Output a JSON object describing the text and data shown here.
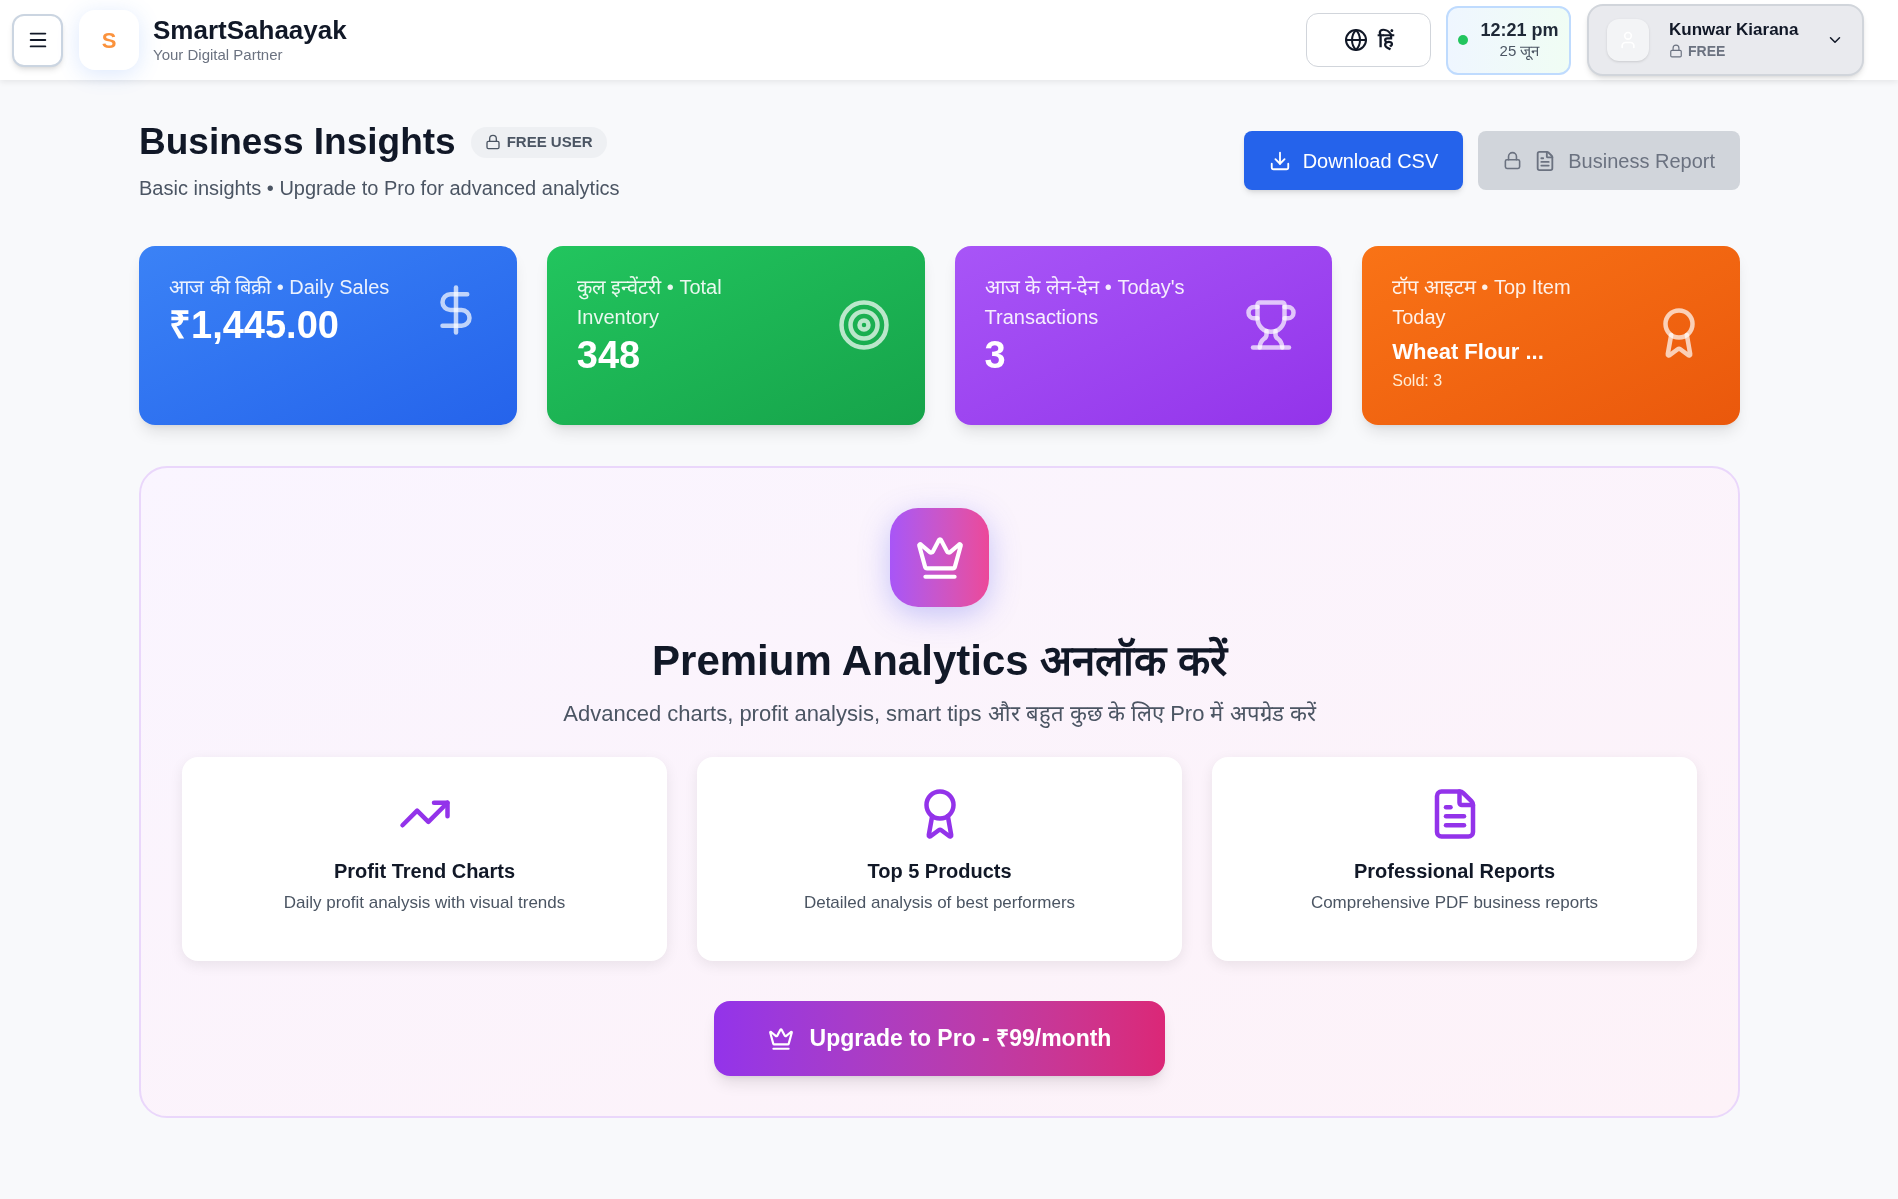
{
  "header": {
    "logo_letter": "S",
    "app_name": "SmartSahaayak",
    "tagline": "Your Digital Partner",
    "language": "हिं",
    "clock": {
      "time": "12:21 pm",
      "date": "25 जून"
    },
    "user": {
      "name": "Kunwar Kiarana",
      "plan": "FREE"
    }
  },
  "page": {
    "title": "Business Insights",
    "badge": "FREE USER",
    "subtitle": "Basic insights • Upgrade to Pro for advanced analytics",
    "actions": [
      {
        "kind": "download",
        "label": "Download CSV",
        "disabled": false
      },
      {
        "kind": "report",
        "label": "Business Report",
        "disabled": true
      }
    ]
  },
  "stats": [
    {
      "kind": "sales",
      "label": "आज की बिक्री • Daily Sales",
      "value": "₹1,445.00"
    },
    {
      "kind": "inventory",
      "label": "कुल इन्वेंटरी • Total Inventory",
      "value": "348"
    },
    {
      "kind": "transactions",
      "label": "आज के लेन-देन • Today's Transactions",
      "value": "3"
    },
    {
      "kind": "top_item",
      "label": "टॉप आइटम • Top Item Today",
      "value": "Wheat Flour ...",
      "note": "Sold: 3"
    }
  ],
  "premium": {
    "title": "Premium Analytics अनलॉक करें",
    "subtitle": "Advanced charts, profit analysis, smart tips और बहुत कुछ के लिए Pro में अपग्रेड करें",
    "features": [
      {
        "kind": "trend",
        "title": "Profit Trend Charts",
        "description": "Daily profit analysis with visual trends"
      },
      {
        "kind": "award",
        "title": "Top 5 Products",
        "description": "Detailed analysis of best performers"
      },
      {
        "kind": "report",
        "title": "Professional Reports",
        "description": "Comprehensive PDF business reports"
      }
    ],
    "upgrade_button": "Upgrade to Pro - ₹99/month"
  }
}
